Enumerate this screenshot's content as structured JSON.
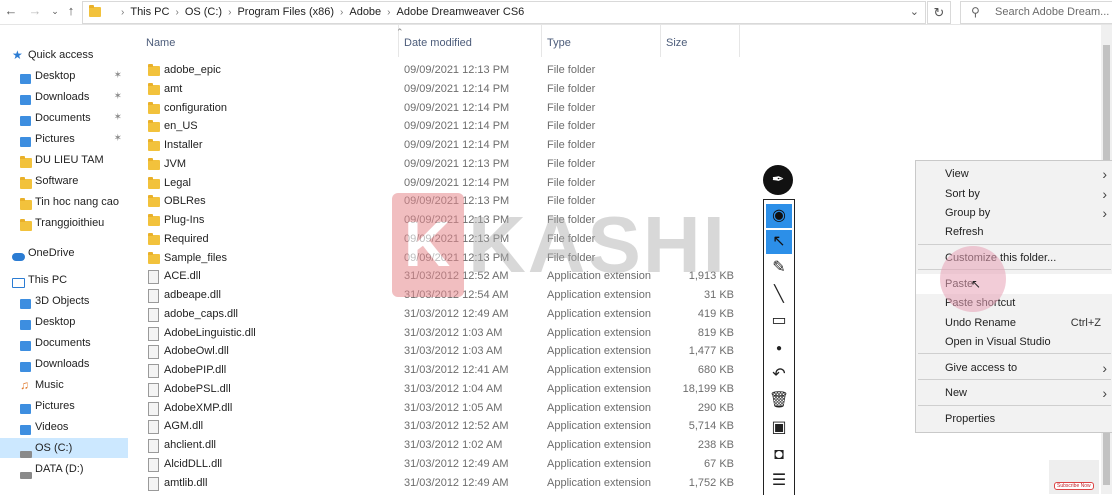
{
  "address_bar": {
    "breadcrumbs": [
      "This PC",
      "OS (C:)",
      "Program Files (x86)",
      "Adobe",
      "Adobe Dreamweaver CS6"
    ],
    "search_placeholder": "Search Adobe Dream..."
  },
  "sidebar": {
    "items": [
      {
        "label": "Quick access",
        "icon": "star-icon"
      },
      {
        "label": "Desktop",
        "icon": "desktop-folder-icon",
        "pinned": true
      },
      {
        "label": "Downloads",
        "icon": "downloads-folder-icon",
        "pinned": true
      },
      {
        "label": "Documents",
        "icon": "documents-folder-icon",
        "pinned": true
      },
      {
        "label": "Pictures",
        "icon": "pictures-folder-icon",
        "pinned": true
      },
      {
        "label": "DU LIEU TAM",
        "icon": "folder-icon"
      },
      {
        "label": "Software",
        "icon": "folder-icon"
      },
      {
        "label": "Tin hoc nang cao",
        "icon": "folder-icon"
      },
      {
        "label": "Tranggioithieu",
        "icon": "folder-icon"
      },
      {
        "label": "OneDrive",
        "icon": "cloud-icon"
      },
      {
        "label": "This PC",
        "icon": "computer-icon"
      },
      {
        "label": "3D Objects",
        "icon": "3d-objects-icon"
      },
      {
        "label": "Desktop",
        "icon": "desktop-folder-icon"
      },
      {
        "label": "Documents",
        "icon": "documents-folder-icon"
      },
      {
        "label": "Downloads",
        "icon": "downloads-folder-icon"
      },
      {
        "label": "Music",
        "icon": "music-icon"
      },
      {
        "label": "Pictures",
        "icon": "pictures-folder-icon"
      },
      {
        "label": "Videos",
        "icon": "videos-folder-icon"
      },
      {
        "label": "OS (C:)",
        "icon": "drive-icon",
        "selected": true
      },
      {
        "label": "DATA (D:)",
        "icon": "drive-icon"
      }
    ]
  },
  "columns": {
    "name": "Name",
    "date": "Date modified",
    "type": "Type",
    "size": "Size"
  },
  "files": [
    {
      "name": "adobe_epic",
      "date": "09/09/2021 12:13 PM",
      "type": "File folder",
      "size": "",
      "kind": "folder"
    },
    {
      "name": "amt",
      "date": "09/09/2021 12:14 PM",
      "type": "File folder",
      "size": "",
      "kind": "folder"
    },
    {
      "name": "configuration",
      "date": "09/09/2021 12:14 PM",
      "type": "File folder",
      "size": "",
      "kind": "folder"
    },
    {
      "name": "en_US",
      "date": "09/09/2021 12:14 PM",
      "type": "File folder",
      "size": "",
      "kind": "folder"
    },
    {
      "name": "Installer",
      "date": "09/09/2021 12:14 PM",
      "type": "File folder",
      "size": "",
      "kind": "folder"
    },
    {
      "name": "JVM",
      "date": "09/09/2021 12:13 PM",
      "type": "File folder",
      "size": "",
      "kind": "folder"
    },
    {
      "name": "Legal",
      "date": "09/09/2021 12:14 PM",
      "type": "File folder",
      "size": "",
      "kind": "folder"
    },
    {
      "name": "OBLRes",
      "date": "09/09/2021 12:13 PM",
      "type": "File folder",
      "size": "",
      "kind": "folder"
    },
    {
      "name": "Plug-Ins",
      "date": "09/09/2021 12:13 PM",
      "type": "File folder",
      "size": "",
      "kind": "folder"
    },
    {
      "name": "Required",
      "date": "09/09/2021 12:13 PM",
      "type": "File folder",
      "size": "",
      "kind": "folder"
    },
    {
      "name": "Sample_files",
      "date": "09/09/2021 12:13 PM",
      "type": "File folder",
      "size": "",
      "kind": "folder"
    },
    {
      "name": "ACE.dll",
      "date": "31/03/2012 12:52 AM",
      "type": "Application extension",
      "size": "1,913 KB",
      "kind": "dll"
    },
    {
      "name": "adbeape.dll",
      "date": "31/03/2012 12:54 AM",
      "type": "Application extension",
      "size": "31 KB",
      "kind": "dll"
    },
    {
      "name": "adobe_caps.dll",
      "date": "31/03/2012 12:49 AM",
      "type": "Application extension",
      "size": "419 KB",
      "kind": "dll"
    },
    {
      "name": "AdobeLinguistic.dll",
      "date": "31/03/2012 1:03 AM",
      "type": "Application extension",
      "size": "819 KB",
      "kind": "dll"
    },
    {
      "name": "AdobeOwl.dll",
      "date": "31/03/2012 1:03 AM",
      "type": "Application extension",
      "size": "1,477 KB",
      "kind": "dll"
    },
    {
      "name": "AdobePIP.dll",
      "date": "31/03/2012 12:41 AM",
      "type": "Application extension",
      "size": "680 KB",
      "kind": "dll"
    },
    {
      "name": "AdobePSL.dll",
      "date": "31/03/2012 1:04 AM",
      "type": "Application extension",
      "size": "18,199 KB",
      "kind": "dll"
    },
    {
      "name": "AdobeXMP.dll",
      "date": "31/03/2012 1:05 AM",
      "type": "Application extension",
      "size": "290 KB",
      "kind": "dll"
    },
    {
      "name": "AGM.dll",
      "date": "31/03/2012 12:52 AM",
      "type": "Application extension",
      "size": "5,714 KB",
      "kind": "dll"
    },
    {
      "name": "ahclient.dll",
      "date": "31/03/2012 1:02 AM",
      "type": "Application extension",
      "size": "238 KB",
      "kind": "dll"
    },
    {
      "name": "AlcidDLL.dll",
      "date": "31/03/2012 12:49 AM",
      "type": "Application extension",
      "size": "67 KB",
      "kind": "dll"
    },
    {
      "name": "amtlib.dll",
      "date": "31/03/2012 12:49 AM",
      "type": "Application extension",
      "size": "1,752 KB",
      "kind": "dll"
    }
  ],
  "watermark": {
    "text": "KASHI"
  },
  "drawing_toolbar": {
    "tools": [
      "view-tool",
      "select-tool",
      "highlighter-tool",
      "line-tool",
      "eraser-tool",
      "dot-tool",
      "undo-tool",
      "delete-tool",
      "presentation-tool",
      "camera-tool",
      "clipboard-tool"
    ],
    "active": [
      "view-tool",
      "select-tool"
    ]
  },
  "context_menu": {
    "items": [
      {
        "label": "View",
        "submenu": true
      },
      {
        "label": "Sort by",
        "submenu": true
      },
      {
        "label": "Group by",
        "submenu": true
      },
      {
        "label": "Refresh"
      },
      {
        "label": "Customize this folder..."
      },
      {
        "label": "Paste",
        "highlighted": true
      },
      {
        "label": "Paste shortcut"
      },
      {
        "label": "Undo Rename",
        "shortcut": "Ctrl+Z"
      },
      {
        "label": "Open in Visual Studio"
      },
      {
        "label": "Give access to",
        "submenu": true
      },
      {
        "label": "New",
        "submenu": true
      },
      {
        "label": "Properties"
      }
    ]
  },
  "subscribe_badge": "Subscribe Now"
}
